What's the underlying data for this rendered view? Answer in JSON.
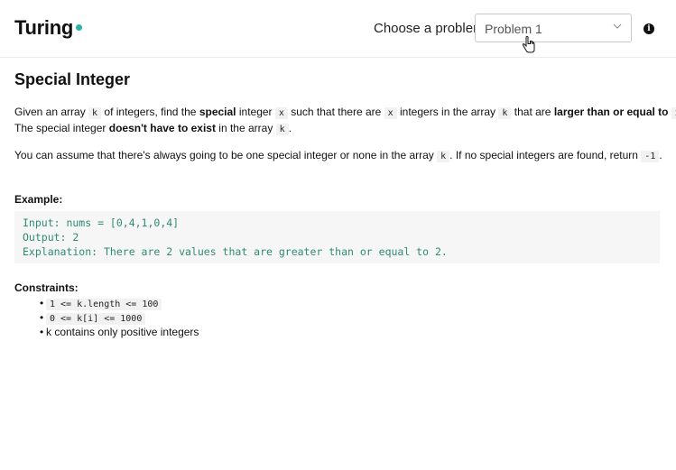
{
  "header": {
    "logo": "Turing",
    "choose_label": "Choose a problem",
    "selected_problem": "Problem 1"
  },
  "problem": {
    "title": "Special Integer",
    "para1": {
      "t1": "Given an array ",
      "c1": "k",
      "t2": " of integers, find the ",
      "b1": "special",
      "t3": " integer ",
      "c2": "x",
      "t4": " such that there are ",
      "c3": "x",
      "t5": " integers in the array ",
      "c4": "k",
      "t6": " that are ",
      "b2": "larger than or equal to",
      "t7": " ",
      "c5": "x",
      "t8": ".",
      "t9": "The special integer ",
      "b3": "doesn't have to exist",
      "t10": " in the array ",
      "c6": "k",
      "t11": "."
    },
    "para2": {
      "t1": "You can assume that there's always going to be one special integer or none in the array ",
      "c1": "k",
      "t2": ". If no special integers are found, return ",
      "c2": "-1",
      "t3": "."
    },
    "example_label": "Example:",
    "example_lines": [
      "Input: nums = [0,4,1,0,4]",
      "Output: 2",
      "Explanation: There are 2 values that are greater than or equal to 2."
    ],
    "constraints_label": "Constraints:",
    "constraints": [
      "1 <= k.length <= 100",
      "0 <= k[i] <= 1000",
      "k contains only positive integers"
    ]
  },
  "colors": {
    "accent": "#2bb3a5",
    "code_text": "#2e8b74"
  },
  "icons": [
    "chevron-down-icon",
    "hand-pointer-icon",
    "info-icon"
  ]
}
